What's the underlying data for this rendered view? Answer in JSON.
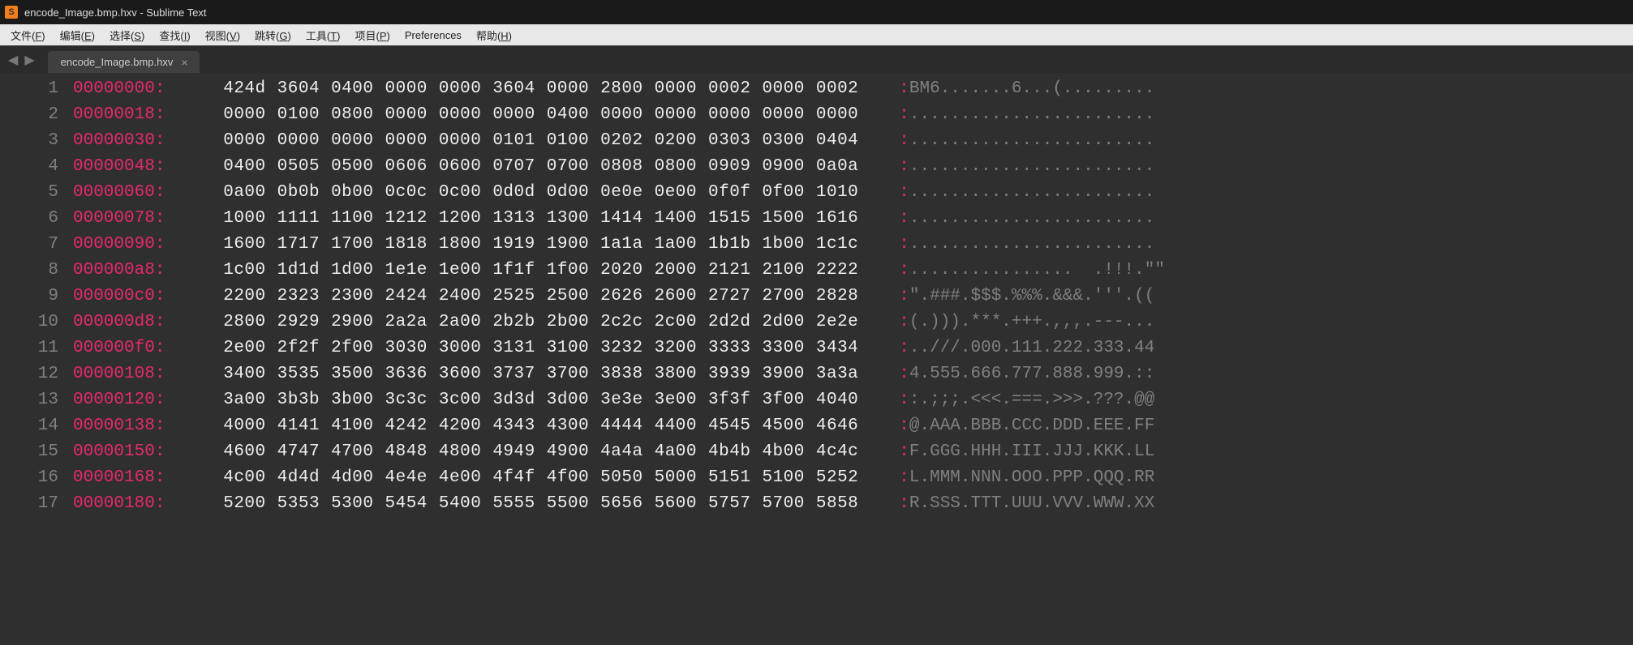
{
  "window": {
    "title": "encode_Image.bmp.hxv - Sublime Text",
    "app_icon_letter": "S"
  },
  "menu": {
    "items": [
      {
        "label": "文件",
        "accel": "F"
      },
      {
        "label": "编辑",
        "accel": "E"
      },
      {
        "label": "选择",
        "accel": "S"
      },
      {
        "label": "查找",
        "accel": "I"
      },
      {
        "label": "视图",
        "accel": "V"
      },
      {
        "label": "跳转",
        "accel": "G"
      },
      {
        "label": "工具",
        "accel": "T"
      },
      {
        "label": "项目",
        "accel": "P"
      },
      {
        "label": "Preferences",
        "accel": ""
      },
      {
        "label": "帮助",
        "accel": "H"
      }
    ]
  },
  "nav": {
    "back": "◀",
    "forward": "▶"
  },
  "tab": {
    "title": "encode_Image.bmp.hxv",
    "close": "×"
  },
  "hex": {
    "lines": [
      {
        "n": "1",
        "addr": "00000000:",
        "bytes": [
          "424d",
          "3604",
          "0400",
          "0000",
          "0000",
          "3604",
          "0000",
          "2800",
          "0000",
          "0002",
          "0000",
          "0002"
        ],
        "ascii": "BM6.......6...(........."
      },
      {
        "n": "2",
        "addr": "00000018:",
        "bytes": [
          "0000",
          "0100",
          "0800",
          "0000",
          "0000",
          "0000",
          "0400",
          "0000",
          "0000",
          "0000",
          "0000",
          "0000"
        ],
        "ascii": "........................"
      },
      {
        "n": "3",
        "addr": "00000030:",
        "bytes": [
          "0000",
          "0000",
          "0000",
          "0000",
          "0000",
          "0101",
          "0100",
          "0202",
          "0200",
          "0303",
          "0300",
          "0404"
        ],
        "ascii": "........................"
      },
      {
        "n": "4",
        "addr": "00000048:",
        "bytes": [
          "0400",
          "0505",
          "0500",
          "0606",
          "0600",
          "0707",
          "0700",
          "0808",
          "0800",
          "0909",
          "0900",
          "0a0a"
        ],
        "ascii": "........................"
      },
      {
        "n": "5",
        "addr": "00000060:",
        "bytes": [
          "0a00",
          "0b0b",
          "0b00",
          "0c0c",
          "0c00",
          "0d0d",
          "0d00",
          "0e0e",
          "0e00",
          "0f0f",
          "0f00",
          "1010"
        ],
        "ascii": "........................"
      },
      {
        "n": "6",
        "addr": "00000078:",
        "bytes": [
          "1000",
          "1111",
          "1100",
          "1212",
          "1200",
          "1313",
          "1300",
          "1414",
          "1400",
          "1515",
          "1500",
          "1616"
        ],
        "ascii": "........................"
      },
      {
        "n": "7",
        "addr": "00000090:",
        "bytes": [
          "1600",
          "1717",
          "1700",
          "1818",
          "1800",
          "1919",
          "1900",
          "1a1a",
          "1a00",
          "1b1b",
          "1b00",
          "1c1c"
        ],
        "ascii": "........................"
      },
      {
        "n": "8",
        "addr": "000000a8:",
        "bytes": [
          "1c00",
          "1d1d",
          "1d00",
          "1e1e",
          "1e00",
          "1f1f",
          "1f00",
          "2020",
          "2000",
          "2121",
          "2100",
          "2222"
        ],
        "ascii": "................  .!!!.\"\""
      },
      {
        "n": "9",
        "addr": "000000c0:",
        "bytes": [
          "2200",
          "2323",
          "2300",
          "2424",
          "2400",
          "2525",
          "2500",
          "2626",
          "2600",
          "2727",
          "2700",
          "2828"
        ],
        "ascii": "\".###.$$$.%%%.&&&.'''.(("
      },
      {
        "n": "10",
        "addr": "000000d8:",
        "bytes": [
          "2800",
          "2929",
          "2900",
          "2a2a",
          "2a00",
          "2b2b",
          "2b00",
          "2c2c",
          "2c00",
          "2d2d",
          "2d00",
          "2e2e"
        ],
        "ascii": "(.))).***.+++.,,,.---..."
      },
      {
        "n": "11",
        "addr": "000000f0:",
        "bytes": [
          "2e00",
          "2f2f",
          "2f00",
          "3030",
          "3000",
          "3131",
          "3100",
          "3232",
          "3200",
          "3333",
          "3300",
          "3434"
        ],
        "ascii": "..///.000.111.222.333.44"
      },
      {
        "n": "12",
        "addr": "00000108:",
        "bytes": [
          "3400",
          "3535",
          "3500",
          "3636",
          "3600",
          "3737",
          "3700",
          "3838",
          "3800",
          "3939",
          "3900",
          "3a3a"
        ],
        "ascii": "4.555.666.777.888.999.::"
      },
      {
        "n": "13",
        "addr": "00000120:",
        "bytes": [
          "3a00",
          "3b3b",
          "3b00",
          "3c3c",
          "3c00",
          "3d3d",
          "3d00",
          "3e3e",
          "3e00",
          "3f3f",
          "3f00",
          "4040"
        ],
        "ascii": ":.;;;.<<<.===.>>>.???.@@"
      },
      {
        "n": "14",
        "addr": "00000138:",
        "bytes": [
          "4000",
          "4141",
          "4100",
          "4242",
          "4200",
          "4343",
          "4300",
          "4444",
          "4400",
          "4545",
          "4500",
          "4646"
        ],
        "ascii": "@.AAA.BBB.CCC.DDD.EEE.FF"
      },
      {
        "n": "15",
        "addr": "00000150:",
        "bytes": [
          "4600",
          "4747",
          "4700",
          "4848",
          "4800",
          "4949",
          "4900",
          "4a4a",
          "4a00",
          "4b4b",
          "4b00",
          "4c4c"
        ],
        "ascii": "F.GGG.HHH.III.JJJ.KKK.LL"
      },
      {
        "n": "16",
        "addr": "00000168:",
        "bytes": [
          "4c00",
          "4d4d",
          "4d00",
          "4e4e",
          "4e00",
          "4f4f",
          "4f00",
          "5050",
          "5000",
          "5151",
          "5100",
          "5252"
        ],
        "ascii": "L.MMM.NNN.OOO.PPP.QQQ.RR"
      },
      {
        "n": "17",
        "addr": "00000180:",
        "bytes": [
          "5200",
          "5353",
          "5300",
          "5454",
          "5400",
          "5555",
          "5500",
          "5656",
          "5600",
          "5757",
          "5700",
          "5858"
        ],
        "ascii": "R.SSS.TTT.UUU.VVV.WWW.XX"
      }
    ]
  }
}
